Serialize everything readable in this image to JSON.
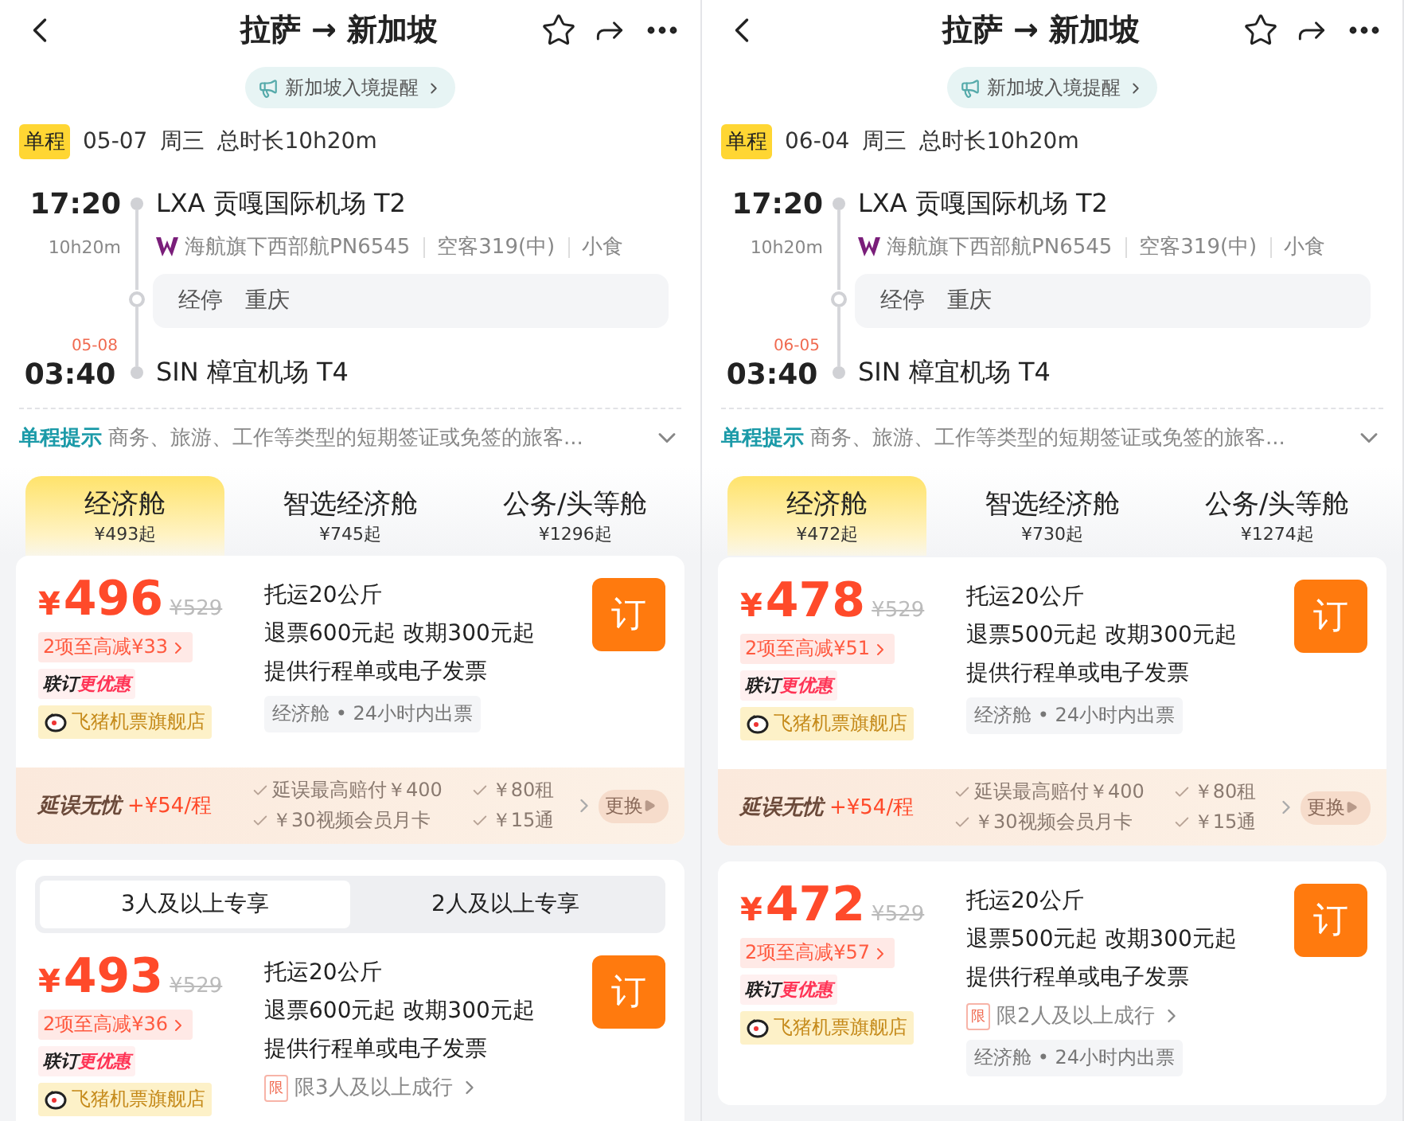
{
  "screens": [
    {
      "header": {
        "title": "拉萨 → 新加坡"
      },
      "notice": "新加坡入境提醒",
      "trip": {
        "badge": "单程",
        "date": "05-07",
        "weekday": "周三",
        "duration": "总时长10h20m"
      },
      "depart": {
        "time": "17:20",
        "airport": "LXA 贡嘎国际机场 T2"
      },
      "elapsed": "10h20m",
      "flight": {
        "airline": "海航旗下西部航PN6545",
        "aircraft": "空客319(中)",
        "meal": "小食"
      },
      "stop": {
        "label": "经停",
        "city": "重庆"
      },
      "arrive": {
        "date": "05-08",
        "time": "03:40",
        "airport": "SIN 樟宜机场 T4"
      },
      "tip": {
        "label": "单程提示",
        "text": "商务、旅游、工作等类型的短期签证或免签的旅客..."
      },
      "cabins": [
        {
          "name": "经济舱",
          "price": "¥493起",
          "selected": true
        },
        {
          "name": "智选经济舱",
          "price": "¥745起",
          "selected": false
        },
        {
          "name": "公务/头等舱",
          "price": "¥1296起",
          "selected": false
        }
      ],
      "cards": [
        {
          "fare": {
            "currency": "¥",
            "amount": "496",
            "original": "¥529",
            "discount": "2项至高减¥33",
            "bundle": {
              "label": "联订",
              "highlight": "更优惠"
            },
            "store": "飞猪机票旗舰店",
            "perks": [
              "托运20公斤",
              "退票600元起 改期300元起",
              "提供行程单或电子发票"
            ],
            "tag": "经济舱 • 24小时内出票",
            "button": "订"
          },
          "addon": {
            "title": "延误无忧",
            "price": "+¥54/程",
            "items": [
              "延误最高赔付￥400",
              "￥80租",
              "￥30视频会员月卡",
              "￥15通"
            ],
            "action": "更换"
          }
        },
        {
          "tabs": [
            {
              "label": "3人及以上专享",
              "selected": true
            },
            {
              "label": "2人及以上专享",
              "selected": false
            }
          ],
          "fare": {
            "currency": "¥",
            "amount": "493",
            "original": "¥529",
            "discount": "2项至高减¥36",
            "bundle": {
              "label": "联订",
              "highlight": "更优惠"
            },
            "store": "飞猪机票旗舰店",
            "perks": [
              "托运20公斤",
              "退票600元起 改期300元起",
              "提供行程单或电子发票"
            ],
            "limit": {
              "badge": "限",
              "text": "限3人及以上成行"
            },
            "button": "订"
          }
        }
      ]
    },
    {
      "header": {
        "title": "拉萨 → 新加坡"
      },
      "notice": "新加坡入境提醒",
      "trip": {
        "badge": "单程",
        "date": "06-04",
        "weekday": "周三",
        "duration": "总时长10h20m"
      },
      "depart": {
        "time": "17:20",
        "airport": "LXA 贡嘎国际机场 T2"
      },
      "elapsed": "10h20m",
      "flight": {
        "airline": "海航旗下西部航PN6545",
        "aircraft": "空客319(中)",
        "meal": "小食"
      },
      "stop": {
        "label": "经停",
        "city": "重庆"
      },
      "arrive": {
        "date": "06-05",
        "time": "03:40",
        "airport": "SIN 樟宜机场 T4"
      },
      "tip": {
        "label": "单程提示",
        "text": "商务、旅游、工作等类型的短期签证或免签的旅客..."
      },
      "cabins": [
        {
          "name": "经济舱",
          "price": "¥472起",
          "selected": true
        },
        {
          "name": "智选经济舱",
          "price": "¥730起",
          "selected": false
        },
        {
          "name": "公务/头等舱",
          "price": "¥1274起",
          "selected": false
        }
      ],
      "cards": [
        {
          "fare": {
            "currency": "¥",
            "amount": "478",
            "original": "¥529",
            "discount": "2项至高减¥51",
            "bundle": {
              "label": "联订",
              "highlight": "更优惠"
            },
            "store": "飞猪机票旗舰店",
            "perks": [
              "托运20公斤",
              "退票500元起 改期300元起",
              "提供行程单或电子发票"
            ],
            "tag": "经济舱 • 24小时内出票",
            "button": "订"
          },
          "addon": {
            "title": "延误无忧",
            "price": "+¥54/程",
            "items": [
              "延误最高赔付￥400",
              "￥80租",
              "￥30视频会员月卡",
              "￥15通"
            ],
            "action": "更换"
          }
        },
        {
          "fare": {
            "currency": "¥",
            "amount": "472",
            "original": "¥529",
            "discount": "2项至高减¥57",
            "bundle": {
              "label": "联订",
              "highlight": "更优惠"
            },
            "store": "飞猪机票旗舰店",
            "perks": [
              "托运20公斤",
              "退票500元起 改期300元起",
              "提供行程单或电子发票"
            ],
            "limit": {
              "badge": "限",
              "text": "限2人及以上成行"
            },
            "tag": "经济舱 • 24小时内出票",
            "button": "订"
          }
        }
      ]
    }
  ]
}
